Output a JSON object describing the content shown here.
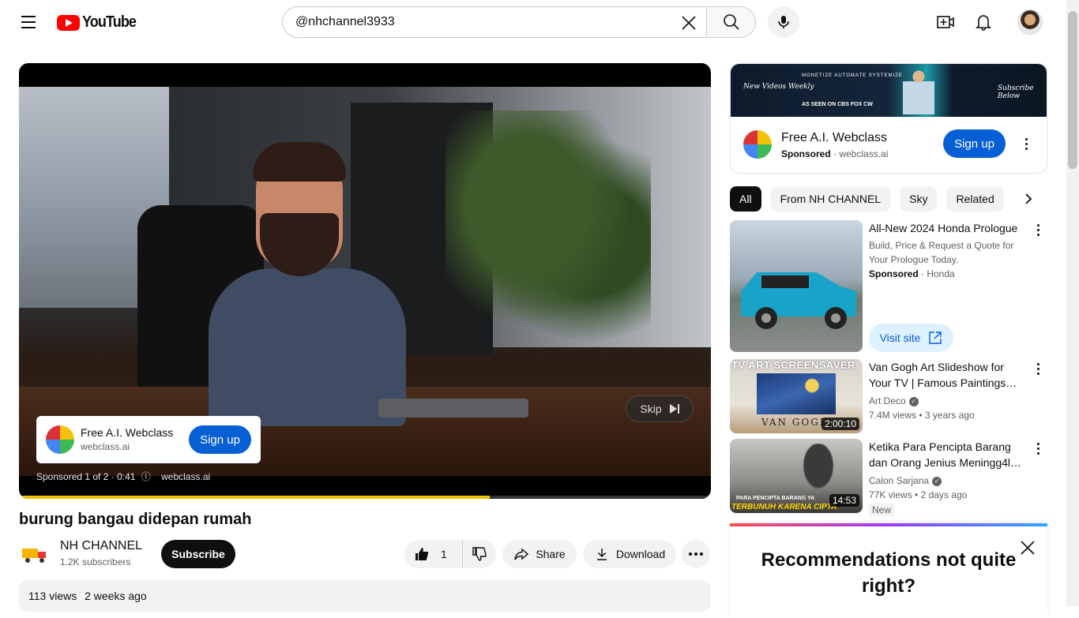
{
  "header": {
    "logo_text": "YouTube",
    "search_value": "@nhchannel3933"
  },
  "player": {
    "ad_overlay": {
      "name": "Free A.I. Webclass",
      "domain": "webclass.ai",
      "cta": "Sign up"
    },
    "skip_label": "Skip",
    "sponsored_text": "Sponsored 1 of 2 · 0:41",
    "sponsored_domain": "webclass.ai",
    "progress_fraction": 0.68,
    "progress_color": "#f0c300"
  },
  "video": {
    "title": "burung bangau didepan rumah",
    "channel_name": "NH CHANNEL",
    "subscribers": "1.2K subscribers",
    "subscribe_label": "Subscribe",
    "like_count": "1",
    "share_label": "Share",
    "download_label": "Download",
    "views": "113 views",
    "posted": "2 weeks ago"
  },
  "side_ad": {
    "banner_left": "New Videos Weekly",
    "banner_tagline": "MONETIZE  AUTOMATE  SYSTEMIZE",
    "banner_press": "AS SEEN ON  CBS  FOX  CW",
    "banner_right": "Subscribe Below",
    "name": "Free A.I. Webclass",
    "sponsored": "Sponsored",
    "domain": "webclass.ai",
    "cta": "Sign up"
  },
  "chips": [
    "All",
    "From NH CHANNEL",
    "Sky",
    "Related"
  ],
  "recommendations": [
    {
      "title": "All-New 2024 Honda Prologue",
      "line2": "Build, Price & Request a Quote for Your Prologue Today.",
      "sponsored": "Sponsored",
      "advertiser": "Honda",
      "cta": "Visit site"
    },
    {
      "title": "Van Gogh Art Slideshow for Your TV | Famous Paintings…",
      "channel": "Art Deco",
      "views": "7.4M views",
      "age": "3 years ago",
      "duration": "2:00:10",
      "thumb_caption_top": "TV ART SCREENSAVER",
      "thumb_caption_bottom": "VAN GOGH"
    },
    {
      "title": "Ketika Para Pencipta Barang dan Orang Jenius Meningg4l…",
      "channel": "Calon Sarjana",
      "views": "77K views",
      "age": "2 days ago",
      "duration": "14:53",
      "badge": "New",
      "thumb_caption_top": "PARA PENCIPTA BARANG YA",
      "thumb_caption_bottom": "TERBUNUH KARENA CIPTA"
    }
  ],
  "feedback": {
    "title": "Recommendations not quite right?"
  },
  "colors": {
    "brand_red": "#ff0000",
    "primary_blue": "#065fd4",
    "chip_bg": "#f2f2f2"
  }
}
